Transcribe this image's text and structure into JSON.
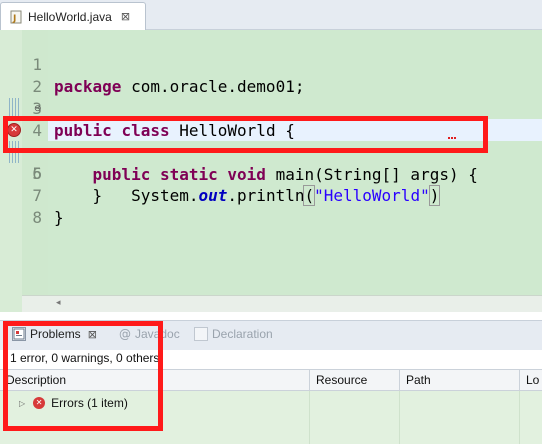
{
  "editor_tab": {
    "label": "HelloWorld.java",
    "close_glyph": "⊠"
  },
  "code": {
    "line_numbers": [
      "1",
      "2",
      "3",
      "4",
      "5",
      "6",
      "7",
      "8"
    ],
    "line1": {
      "kw": "package",
      "rest": " com.oracle.demo01;"
    },
    "line3": {
      "kw1": "public",
      "kw2": "class",
      "rest": " HelloWorld {"
    },
    "line4": {
      "indent": "    ",
      "kw1": "public",
      "kw2": "static",
      "kw3": "void",
      "rest": " main(String[] args) {"
    },
    "line5": {
      "indent": "        ",
      "pre": "System.",
      "field": "out",
      "mid": ".println",
      "open": "(",
      "string": "\"HelloWorld\"",
      "close": ")"
    },
    "line6": {
      "text": "    }"
    },
    "line7": {
      "text": "}"
    },
    "fold_marker": "⊖",
    "error_glyph": "✕"
  },
  "problems_view": {
    "tabs": [
      {
        "label": "Problems",
        "close_glyph": "⊠",
        "active": true
      },
      {
        "label": "Javadoc",
        "active": false
      },
      {
        "label": "Declaration",
        "active": false
      }
    ],
    "summary": "1 error, 0 warnings, 0 others",
    "columns": [
      "Description",
      "Resource",
      "Path",
      "Lo"
    ],
    "rows": [
      {
        "expand_glyph": "▷",
        "label": "Errors (1 item)"
      }
    ]
  },
  "scroll_left_glyph": "◂",
  "colors": {
    "editor_bg": "#cfe9cf",
    "current_line": "#e8f2fe",
    "keyword": "#7f0055",
    "string": "#2a00ff",
    "field": "#0000c0",
    "highlight_box": "#ff1a1a",
    "error": "#d73a3a"
  }
}
